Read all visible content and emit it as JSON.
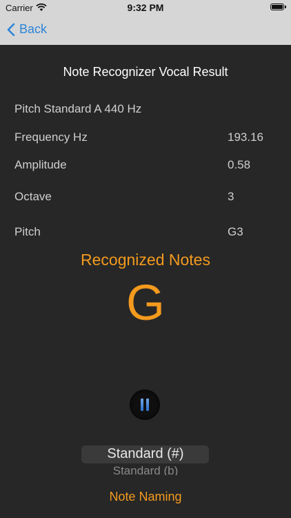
{
  "status_bar": {
    "carrier": "Carrier",
    "time": "9:32 PM"
  },
  "nav": {
    "back_label": "Back"
  },
  "title": "Note Recognizer Vocal Result",
  "pitch_standard": "Pitch Standard A 440 Hz",
  "rows": [
    {
      "label": "Frequency Hz",
      "value": "193.16"
    },
    {
      "label": "Amplitude",
      "value": "0.58"
    },
    {
      "label": "Octave",
      "value": "3"
    },
    {
      "label": "Pitch",
      "value": "G3"
    }
  ],
  "recognized_label": "Recognized Notes",
  "recognized_note": "G",
  "picker": {
    "selected": "Standard (#)",
    "next": "Standard (b)"
  },
  "note_naming_label": "Note Naming",
  "colors": {
    "accent": "#f39a1e",
    "link": "#2d84d8",
    "background": "#272727",
    "bar": "#d6d6d6"
  }
}
